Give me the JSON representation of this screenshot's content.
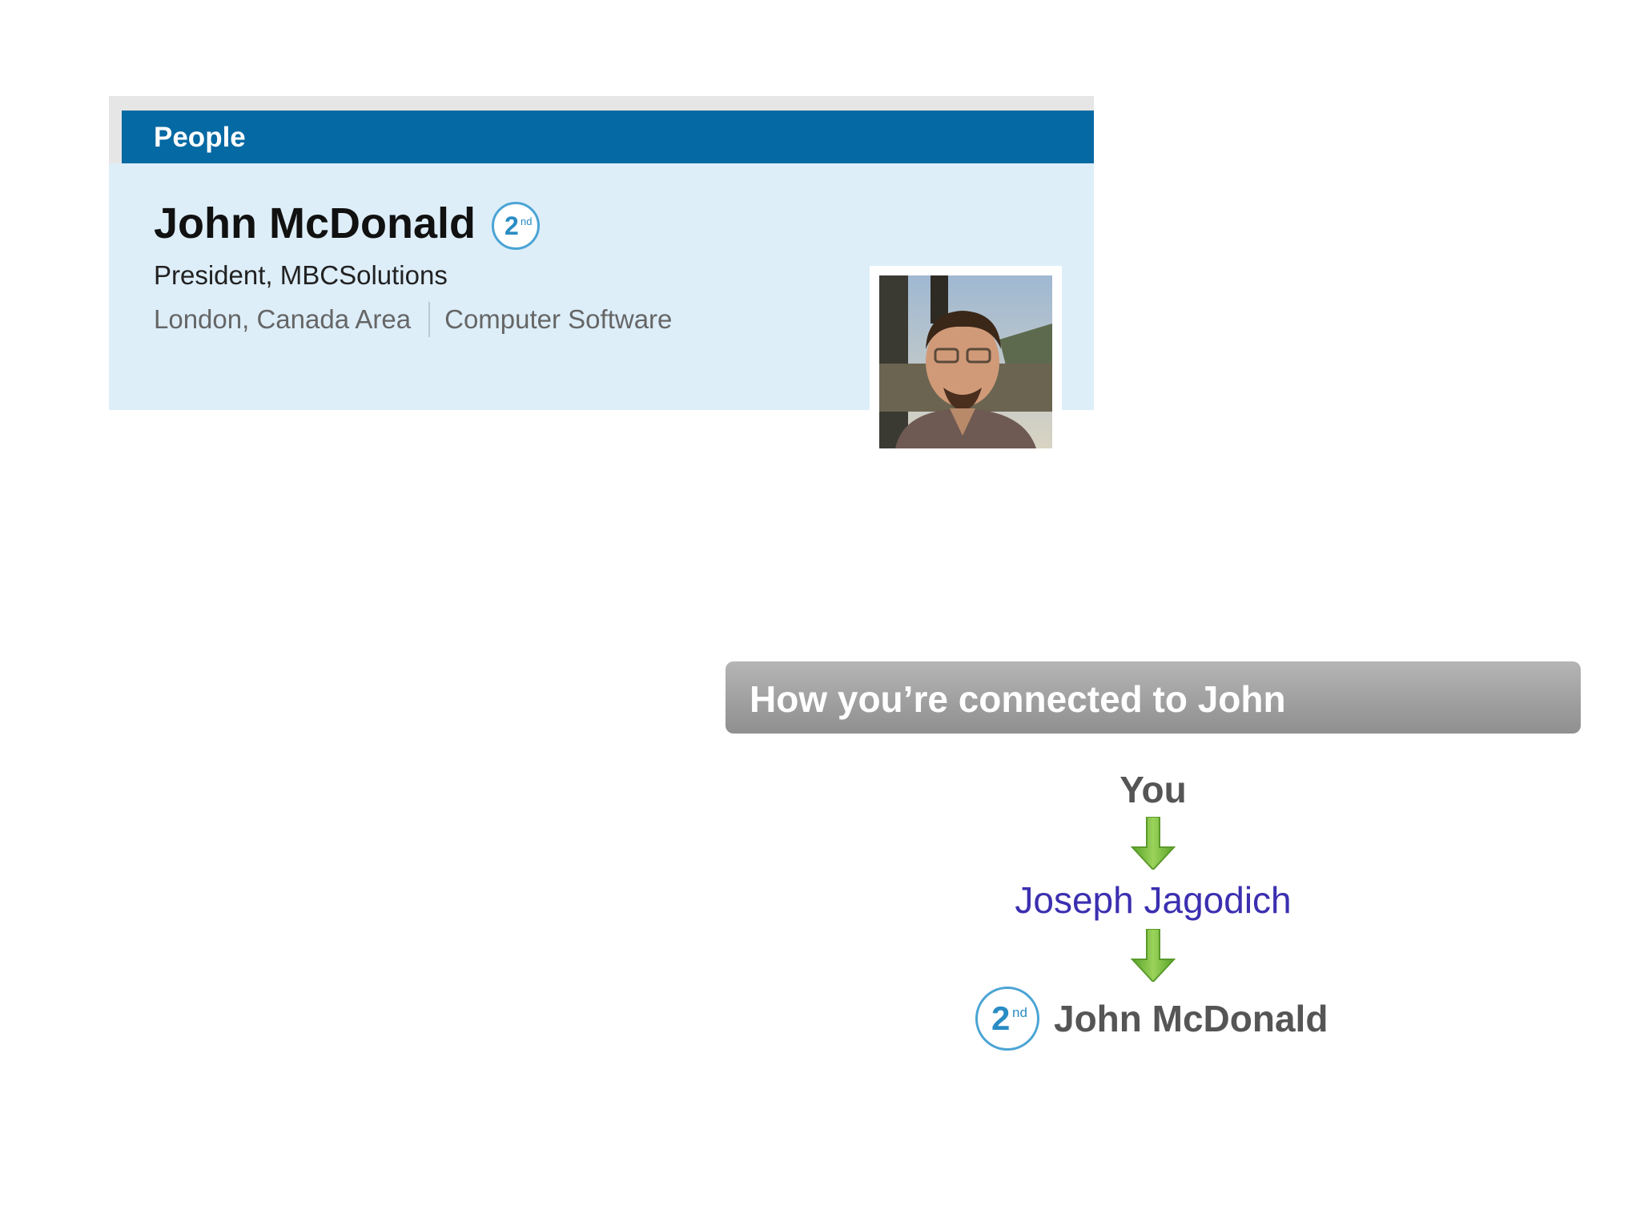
{
  "people_card": {
    "header_title": "People",
    "name": "John McDonald",
    "degree": {
      "number": "2",
      "suffix": "nd"
    },
    "title": "President, MBCSolutions",
    "location": "London, Canada Area",
    "industry": "Computer Software",
    "avatar_icon": "person-photo-icon"
  },
  "connection": {
    "header_title": "How you’re connected to John",
    "you_label": "You",
    "intermediate_name": "Joseph Jagodich",
    "target_name": "John McDonald",
    "target_degree": {
      "number": "2",
      "suffix": "nd"
    },
    "arrow_icon": "arrow-down-icon"
  },
  "colors": {
    "header_blue": "#0569a3",
    "card_background": "#ddeef9",
    "badge_blue": "#2a8cc4",
    "link_purple": "#3b2fb0",
    "arrow_green": "#7cc242",
    "gray_header": "#a3a3a3"
  }
}
